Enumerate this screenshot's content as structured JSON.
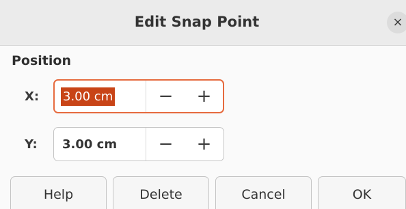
{
  "dialog": {
    "title": "Edit Snap Point",
    "close_glyph": "×"
  },
  "position": {
    "section_label": "Position",
    "x": {
      "label": "X:",
      "value": "3.00 cm",
      "focused": true,
      "selected": true
    },
    "y": {
      "label": "Y:",
      "value": "3.00 cm"
    },
    "minus_glyph": "−",
    "plus_glyph": "+"
  },
  "buttons": {
    "help": "Help",
    "delete": "Delete",
    "cancel": "Cancel",
    "ok": "OK"
  },
  "colors": {
    "focus_ring": "#e66a3e",
    "selection": "#c84417"
  },
  "icons": {
    "close": "close-icon",
    "decrement": "minus-icon",
    "increment": "plus-icon"
  }
}
